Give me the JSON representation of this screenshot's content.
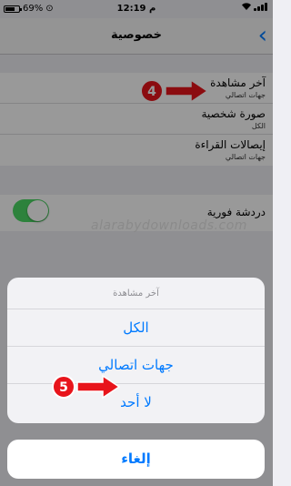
{
  "status_bar": {
    "battery": "69%",
    "time": "12:19",
    "time_suffix": "م",
    "battery_level": 0.69
  },
  "nav": {
    "title": "خصوصية",
    "back_glyph": "‹"
  },
  "settings": [
    {
      "title": "آخر مشاهدة",
      "value": "جهات اتصالي"
    },
    {
      "title": "صورة شخصية",
      "value": "الكل"
    },
    {
      "title": "إيصالات القراءة",
      "value": "جهات اتصالي"
    }
  ],
  "instant_chat": {
    "label": "دردشة فورية",
    "enabled": true
  },
  "watermark": "alarabydownloads.com",
  "markers": {
    "step4": "4",
    "step5": "5"
  },
  "action_sheet": {
    "title": "آخر مشاهدة",
    "options": [
      "الكل",
      "جهات اتصالي",
      "لا أحد"
    ],
    "cancel": "إلغاء"
  },
  "colors": {
    "accent": "#007aff",
    "toggle_on": "#4cd964",
    "marker_red": "#e8141b"
  }
}
